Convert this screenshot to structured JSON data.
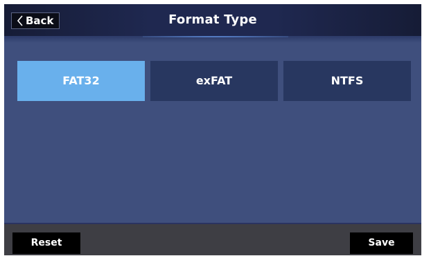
{
  "header": {
    "back_label": "Back",
    "back_icon": "chevron-left-icon",
    "title": "Format Type"
  },
  "options": [
    {
      "label": "FAT32",
      "selected": true
    },
    {
      "label": "exFAT",
      "selected": false
    },
    {
      "label": "NTFS",
      "selected": false
    }
  ],
  "footer": {
    "reset_label": "Reset",
    "save_label": "Save"
  },
  "colors": {
    "background": "#3f4f7d",
    "header": "#1f2850",
    "option": "#283760",
    "option_selected": "#69b0ec",
    "footer": "#3e3e44"
  }
}
